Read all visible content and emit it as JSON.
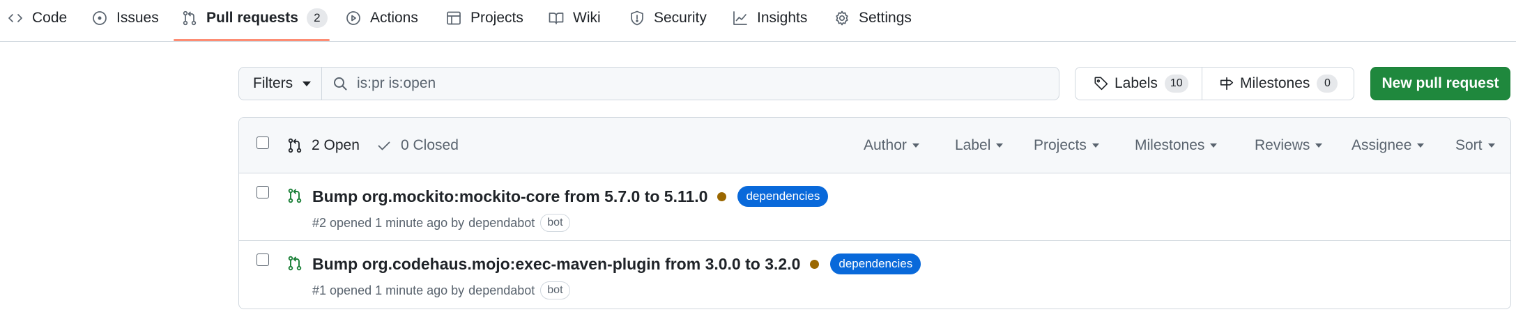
{
  "repo_nav": {
    "items": [
      {
        "label": "Code",
        "icon": "code-icon"
      },
      {
        "label": "Issues",
        "icon": "issue-opened-icon"
      },
      {
        "label": "Pull requests",
        "icon": "git-pull-request-icon",
        "counter": "2",
        "selected": true
      },
      {
        "label": "Actions",
        "icon": "play-icon"
      },
      {
        "label": "Projects",
        "icon": "table-icon"
      },
      {
        "label": "Wiki",
        "icon": "book-icon"
      },
      {
        "label": "Security",
        "icon": "shield-icon"
      },
      {
        "label": "Insights",
        "icon": "graph-icon"
      },
      {
        "label": "Settings",
        "icon": "gear-icon"
      }
    ],
    "selected_underline_color": "#fd8c73"
  },
  "subnav": {
    "filters_label": "Filters",
    "search_value": "is:pr is:open",
    "labels": {
      "label": "Labels",
      "count": "10"
    },
    "milestones": {
      "label": "Milestones",
      "count": "0"
    },
    "new_button_label": "New pull request",
    "new_button_color": "#1f883d"
  },
  "list_header": {
    "open_label": "2 Open",
    "closed_label": "0 Closed",
    "filters": [
      "Author",
      "Label",
      "Projects",
      "Milestones",
      "Reviews",
      "Assignee",
      "Sort"
    ]
  },
  "pull_requests": [
    {
      "title": "Bump org.mockito:mockito-core from 5.7.0 to 5.11.0",
      "status_color": "#9a6700",
      "label": "dependencies",
      "label_color": "#0969da",
      "meta_prefix": "#2 opened 1 minute ago by",
      "author": "dependabot",
      "author_badge": "bot"
    },
    {
      "title": "Bump org.codehaus.mojo:exec-maven-plugin from 3.0.0 to 3.2.0",
      "status_color": "#9a6700",
      "label": "dependencies",
      "label_color": "#0969da",
      "meta_prefix": "#1 opened 1 minute ago by",
      "author": "dependabot",
      "author_badge": "bot"
    }
  ]
}
